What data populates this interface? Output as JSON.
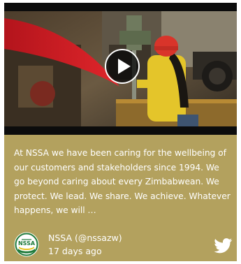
{
  "post": {
    "text": "At NSSA we have been caring for the wellbeing of our customers and stakeholders since 1994. We go beyond caring about every Zimbabwean. We protect. We lead. We share. We achieve. Whatever happens, we will …",
    "account_display": "NSSA (@nssazw)",
    "time_ago": "17 days ago",
    "avatar_logo_text": "NSSA",
    "media_type": "video"
  },
  "icons": {
    "play": "play-icon",
    "platform": "twitter-bird-icon",
    "avatar": "nssa-logo-icon"
  },
  "colors": {
    "card_background": "#b3a15e",
    "text": "#ffffff",
    "play_button_fill": "#0a0a0a",
    "logo_green": "#1f7a3a",
    "logo_yellow": "#e8c21c"
  }
}
